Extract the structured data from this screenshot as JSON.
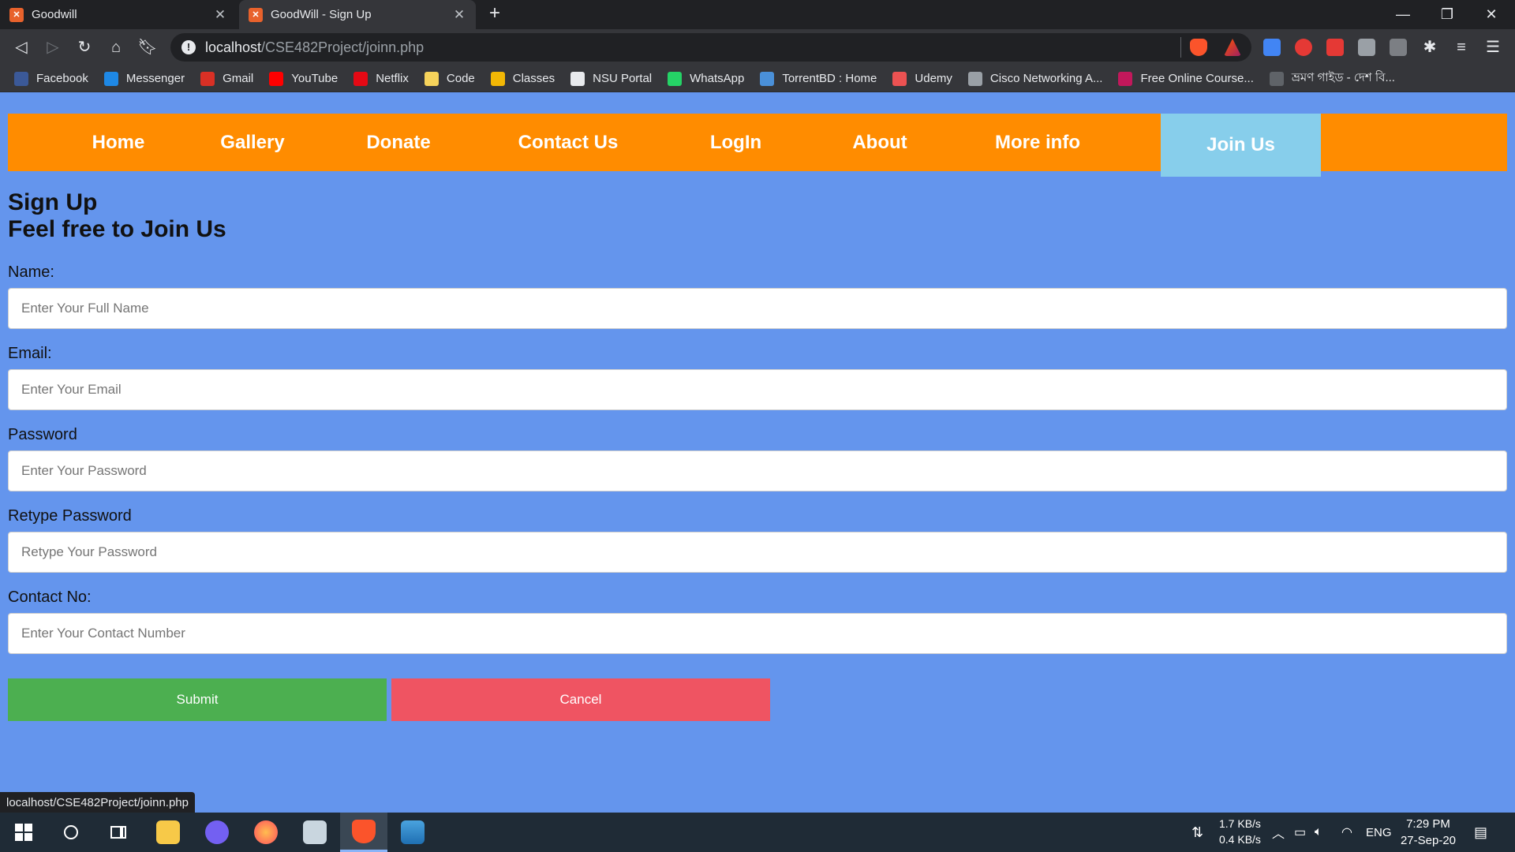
{
  "browser": {
    "tabs": [
      {
        "title": "Goodwill"
      },
      {
        "title": "GoodWill - Sign Up"
      }
    ],
    "url_host": "localhost",
    "url_path": "/CSE482Project/joinn.php",
    "bookmarks": [
      {
        "label": "Facebook",
        "color": "#3b5998"
      },
      {
        "label": "Messenger",
        "color": "#1e88e5"
      },
      {
        "label": "Gmail",
        "color": "#d93025"
      },
      {
        "label": "YouTube",
        "color": "#ff0000"
      },
      {
        "label": "Netflix",
        "color": "#e50914"
      },
      {
        "label": "Code",
        "color": "#f6d35b"
      },
      {
        "label": "Classes",
        "color": "#f2b705"
      },
      {
        "label": "NSU Portal",
        "color": "#e8eaed"
      },
      {
        "label": "WhatsApp",
        "color": "#25d366"
      },
      {
        "label": "TorrentBD : Home",
        "color": "#4a90d9"
      },
      {
        "label": "Udemy",
        "color": "#ec5252"
      },
      {
        "label": "Cisco Networking A...",
        "color": "#9aa0a6"
      },
      {
        "label": "Free Online Course...",
        "color": "#c2185b"
      },
      {
        "label": "ভ্রমণ গাইড - দেশ বি...",
        "color": "#5f6368"
      }
    ],
    "status_url": "localhost/CSE482Project/joinn.php"
  },
  "site": {
    "nav": [
      {
        "label": "Home"
      },
      {
        "label": "Gallery"
      },
      {
        "label": "Donate"
      },
      {
        "label": "Contact Us"
      },
      {
        "label": "LogIn"
      },
      {
        "label": "About"
      },
      {
        "label": "More info"
      },
      {
        "label": "Join Us",
        "active": true
      }
    ],
    "heading_line1": "Sign Up",
    "heading_line2": "Feel free to Join Us",
    "form": {
      "name_label": "Name:",
      "name_placeholder": "Enter Your Full Name",
      "email_label": "Email:",
      "email_placeholder": "Enter Your Email",
      "password_label": "Password",
      "password_placeholder": "Enter Your Password",
      "retype_label": "Retype Password",
      "retype_placeholder": "Retype Your Password",
      "contact_label": "Contact No:",
      "contact_placeholder": "Enter Your Contact Number",
      "submit_label": "Submit",
      "cancel_label": "Cancel"
    }
  },
  "taskbar": {
    "download_speed": "1.7 KB/s",
    "upload_speed": "0.4 KB/s",
    "language": "ENG",
    "time": "7:29 PM",
    "date": "27-Sep-20"
  },
  "colors": {
    "page_bg": "#6495ed",
    "nav_bg": "#ff8c00",
    "nav_active_bg": "#87ceeb",
    "submit_bg": "#4caf50",
    "cancel_bg": "#ef5462"
  }
}
